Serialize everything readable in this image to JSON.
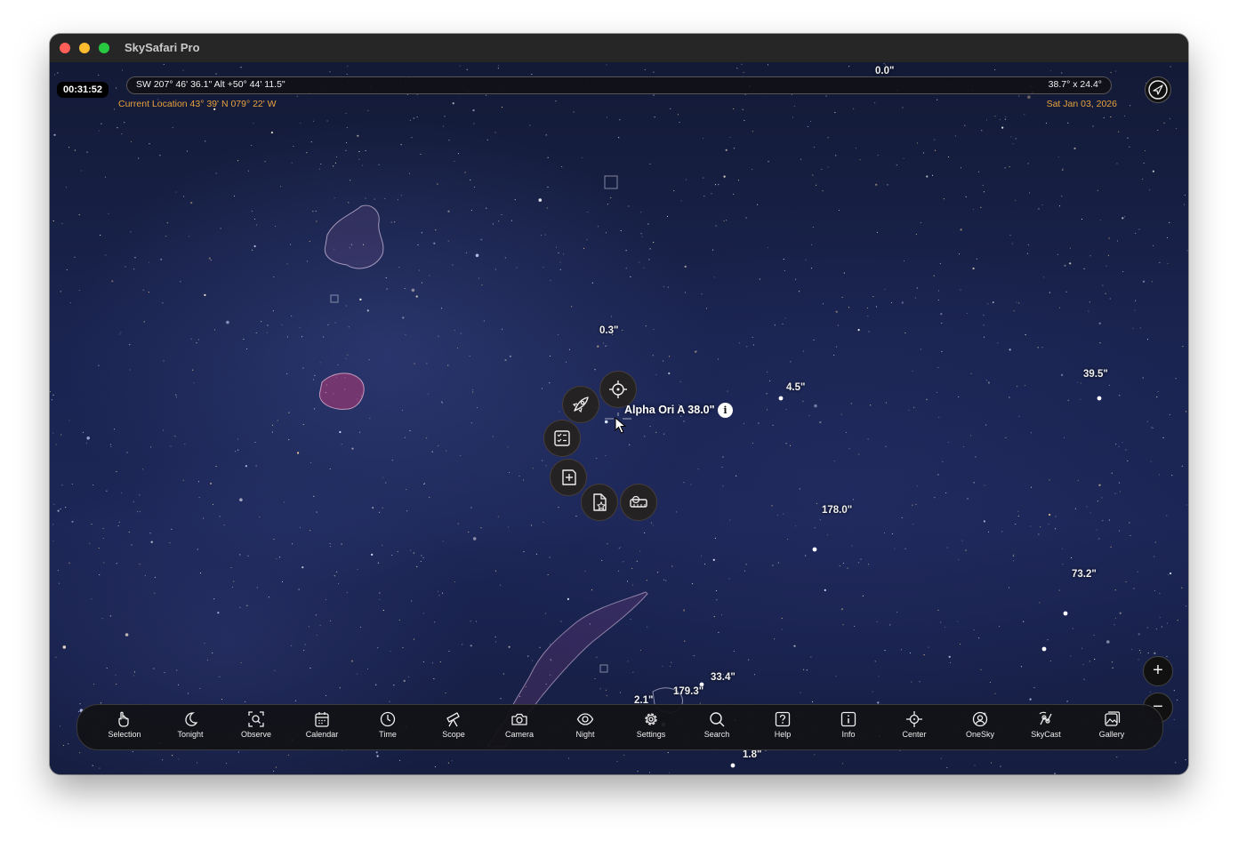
{
  "app": {
    "title": "SkySafari Pro"
  },
  "header": {
    "clock": "00:31:52",
    "coordinates": "SW 207° 46' 36.1\" Alt +50° 44' 11.5\"",
    "field_of_view": "38.7° x 24.4°",
    "location": "Current Location  43° 39' N 079° 22' W",
    "date": "Sat Jan 03, 2026"
  },
  "selection": {
    "label": "Alpha Ori A 38.0\"",
    "info": "i",
    "actions": [
      {
        "name": "center-target",
        "icon": "crosshair-icon"
      },
      {
        "name": "goto-rocket",
        "icon": "rocket-icon"
      },
      {
        "name": "observing-list",
        "icon": "checklist-icon"
      },
      {
        "name": "add-to-list",
        "icon": "add-note-icon"
      },
      {
        "name": "favorite-document",
        "icon": "star-document-icon"
      },
      {
        "name": "measure",
        "icon": "ruler-icon"
      }
    ]
  },
  "sky_labels": [
    "0.0\"",
    "0.3\"",
    "4.5\"",
    "39.5\"",
    "178.0\"",
    "73.2\"",
    "33.4\"",
    "179.3\"",
    "2.1\"",
    "1.8\""
  ],
  "zoom": {
    "in": "+",
    "out": "−"
  },
  "toolbar": {
    "items": [
      {
        "label": "Selection",
        "icon": "hand-pointer-icon"
      },
      {
        "label": "Tonight",
        "icon": "moon-icon"
      },
      {
        "label": "Observe",
        "icon": "observe-scan-icon"
      },
      {
        "label": "Calendar",
        "icon": "calendar-icon"
      },
      {
        "label": "Time",
        "icon": "clock-icon"
      },
      {
        "label": "Scope",
        "icon": "telescope-icon"
      },
      {
        "label": "Camera",
        "icon": "camera-icon"
      },
      {
        "label": "Night",
        "icon": "eye-icon"
      },
      {
        "label": "Settings",
        "icon": "gear-icon"
      },
      {
        "label": "Search",
        "icon": "search-icon"
      },
      {
        "label": "Help",
        "icon": "help-icon"
      },
      {
        "label": "Info",
        "icon": "info-icon"
      },
      {
        "label": "Center",
        "icon": "crosshair-icon"
      },
      {
        "label": "OneSky",
        "icon": "onesky-icon"
      },
      {
        "label": "SkyCast",
        "icon": "skycast-icon"
      },
      {
        "label": "Gallery",
        "icon": "gallery-icon"
      }
    ]
  },
  "colors": {
    "sky_top": "#131a36",
    "sky_mid": "#1c2656",
    "orange_text": "#e8a23c",
    "toolbar_bg": "#121216"
  }
}
